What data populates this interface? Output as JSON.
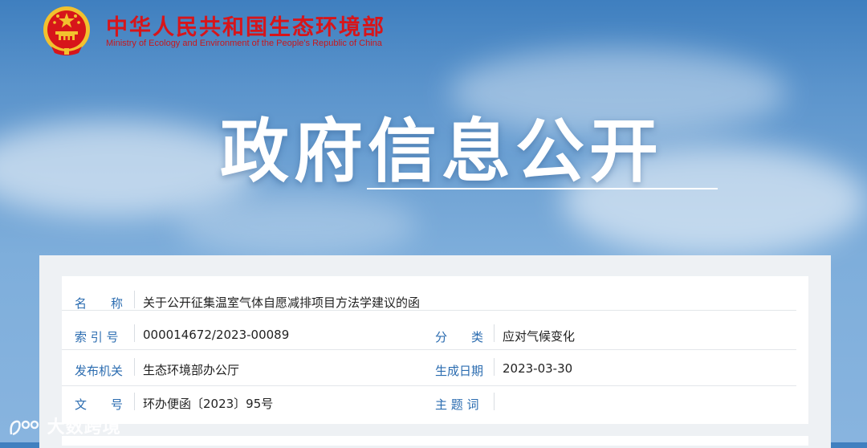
{
  "header": {
    "title_cn": "中华人民共和国生态环境部",
    "title_en": "Ministry of Ecology and Environment of the People's Republic of China"
  },
  "banner": {
    "title": "政府信息公开"
  },
  "info": {
    "name_label": "名　　称",
    "name_value": "关于公开征集温室气体自愿减排项目方法学建议的函",
    "index_label": "索 引 号",
    "index_value": "000014672/2023-00089",
    "category_label": "分　　类",
    "category_value": "应对气候变化",
    "issuer_label": "发布机关",
    "issuer_value": "生态环境部办公厅",
    "date_label": "生成日期",
    "date_value": "2023-03-30",
    "doc_label": "文　　号",
    "doc_value": "环办便函〔2023〕95号",
    "subject_label": "主 题 词",
    "subject_value": ""
  },
  "watermark": {
    "text": "大数跨境"
  },
  "colors": {
    "label_blue": "#2b6cb0",
    "title_red": "#d7151a"
  }
}
